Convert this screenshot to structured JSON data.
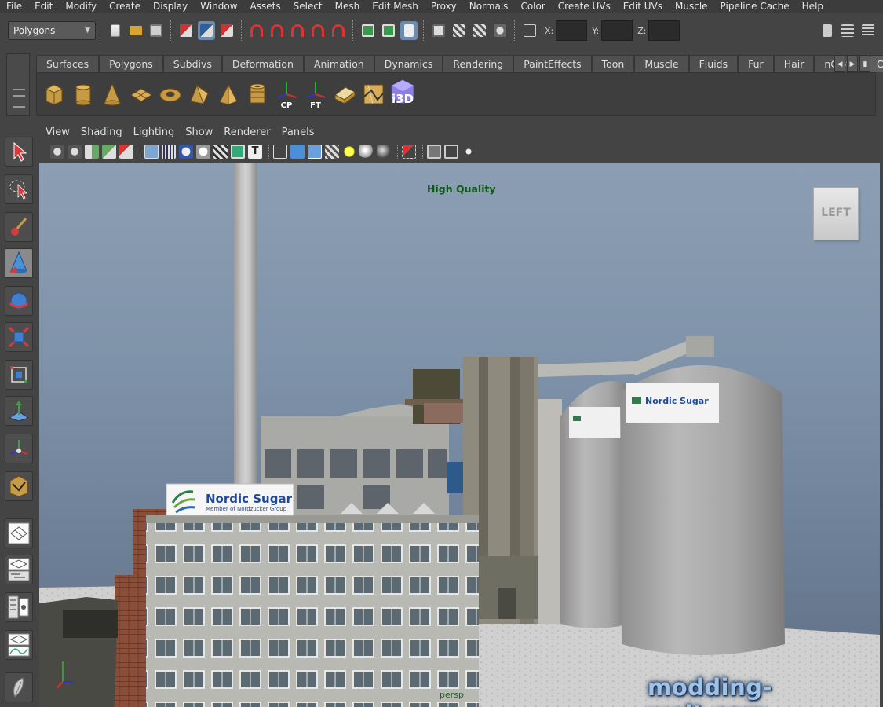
{
  "menu": [
    "File",
    "Edit",
    "Modify",
    "Create",
    "Display",
    "Window",
    "Assets",
    "Select",
    "Mesh",
    "Edit Mesh",
    "Proxy",
    "Normals",
    "Color",
    "Create UVs",
    "Edit UVs",
    "Muscle",
    "Pipeline Cache",
    "Help"
  ],
  "statusline": {
    "mode": "Polygons",
    "coord_x_label": "X:",
    "coord_y_label": "Y:",
    "coord_z_label": "Z:"
  },
  "shelf": {
    "tabs": [
      "Surfaces",
      "Polygons",
      "Subdivs",
      "Deformation",
      "Animation",
      "Dynamics",
      "Rendering",
      "PaintEffects",
      "Toon",
      "Muscle",
      "Fluids",
      "Fur",
      "Hair",
      "nCloth",
      "Custom"
    ],
    "active_tab": "Custom",
    "icons": [
      {
        "name": "poly-cube-icon",
        "label": ""
      },
      {
        "name": "poly-cylinder-icon",
        "label": ""
      },
      {
        "name": "poly-cone-icon",
        "label": ""
      },
      {
        "name": "poly-plane-icon",
        "label": ""
      },
      {
        "name": "poly-torus-icon",
        "label": ""
      },
      {
        "name": "poly-prism-icon",
        "label": ""
      },
      {
        "name": "poly-pyramid-icon",
        "label": ""
      },
      {
        "name": "poly-pipe-icon",
        "label": ""
      },
      {
        "name": "center-pivot-icon",
        "label": "CP"
      },
      {
        "name": "freeze-transform-icon",
        "label": "FT"
      },
      {
        "name": "uv-map-icon",
        "label": ""
      },
      {
        "name": "uv-editor-icon",
        "label": ""
      },
      {
        "name": "i3d-export-icon",
        "label": "i3D"
      }
    ]
  },
  "panel": {
    "menu": [
      "View",
      "Shading",
      "Lighting",
      "Show",
      "Renderer",
      "Panels"
    ]
  },
  "viewport": {
    "hq_label": "High Quality",
    "viewcube_label": "LEFT",
    "camera_label": "persp",
    "sign_title": "Nordic Sugar",
    "sign_subtitle": "Member of Nordzucker Group",
    "silo_sign": "Nordic Sugar",
    "watermark": "modding-welt.com"
  },
  "colors": {
    "menu_bg": "#3c3c3c",
    "ui_bg": "#444444",
    "active_blue": "#6b8bb0",
    "hq_green": "#0d5a18",
    "watermark": "#9fc2e8"
  }
}
